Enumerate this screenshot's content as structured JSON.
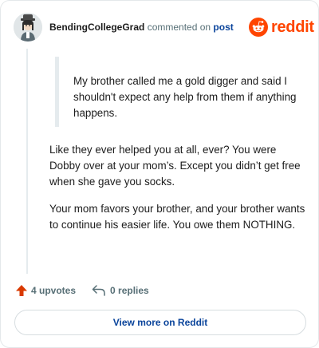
{
  "header": {
    "username": "BendingCollegeGrad",
    "commented_text": "commented on",
    "post_link": "post",
    "logo_text": "reddit"
  },
  "comment": {
    "quote": "My brother called me a gold digger and said I shouldn't expect any help from them if anything happens.",
    "paragraphs": [
      "Like they ever helped you at all, ever? You were Dobby over at your mom’s. Except you didn’t get free when she gave you socks.",
      "Your mom favors your brother, and your brother wants to continue his easier life. You owe them NOTHING."
    ]
  },
  "actions": {
    "upvotes": "4 upvotes",
    "replies": "0 replies"
  },
  "footer": {
    "view_more": "View more on Reddit"
  },
  "colors": {
    "brand": "#ff4500",
    "link": "#0a449b",
    "muted": "#576f76",
    "upvote": "#d93a00"
  },
  "icons": [
    "avatar",
    "reddit-snoo-icon",
    "upvote-arrow-icon",
    "reply-arrow-icon"
  ]
}
